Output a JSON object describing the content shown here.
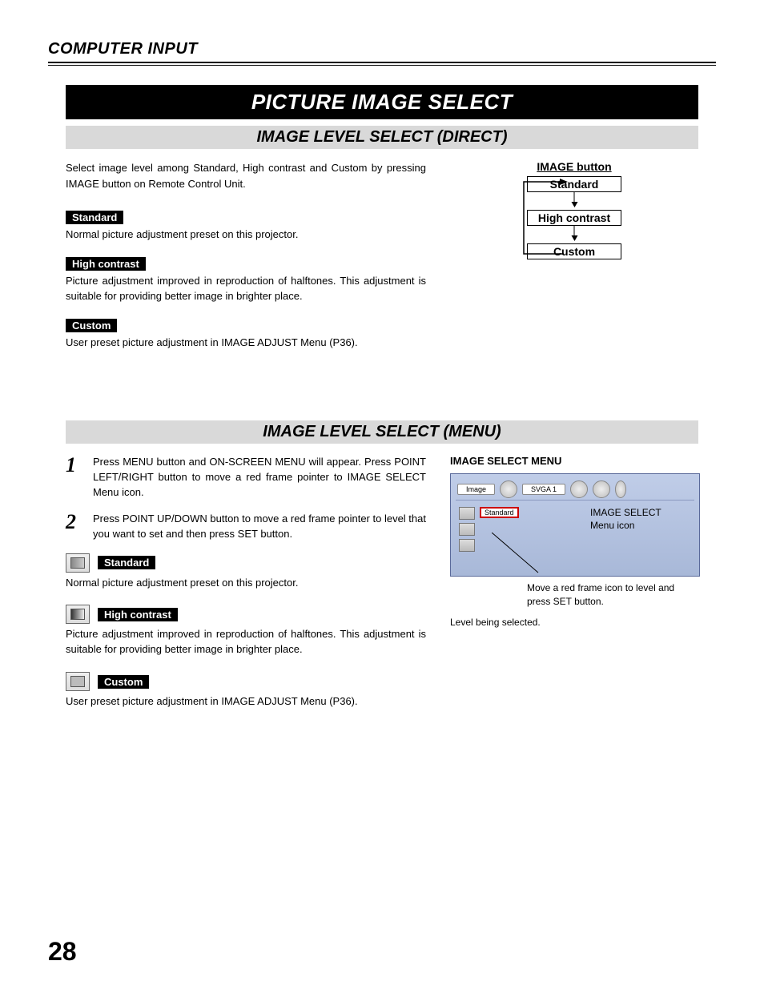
{
  "header": "COMPUTER INPUT",
  "title_bar": "PICTURE IMAGE SELECT",
  "subtitle1": "IMAGE LEVEL SELECT (DIRECT)",
  "direct": {
    "intro": "Select image level among Standard, High contrast and Custom by pressing IMAGE button on Remote Control Unit.",
    "standard_label": "Standard",
    "standard_desc": "Normal picture adjustment preset on this projector.",
    "high_label": "High contrast",
    "high_desc": "Picture adjustment improved in reproduction of halftones. This adjustment is suitable for providing better image in brighter place.",
    "custom_label": "Custom",
    "custom_desc": "User preset picture adjustment in IMAGE ADJUST Menu (P36)."
  },
  "diagram": {
    "title": "IMAGE button",
    "box1": "Standard",
    "box2": "High contrast",
    "box3": "Custom"
  },
  "subtitle2": "IMAGE LEVEL SELECT (MENU)",
  "menu": {
    "step1": "Press MENU button and ON-SCREEN MENU will appear.  Press POINT LEFT/RIGHT button to move a red frame pointer to IMAGE SELECT Menu icon.",
    "step2": "Press POINT UP/DOWN button to move a red frame pointer to level that you want to set and then press SET button.",
    "standard_label": "Standard",
    "standard_desc": "Normal picture adjustment preset on this projector.",
    "high_label": "High contrast",
    "high_desc": "Picture adjustment improved in reproduction of halftones. This adjustment is suitable for providing better image in brighter place.",
    "custom_label": "Custom",
    "custom_desc": "User preset picture adjustment in IMAGE ADJUST Menu (P36)."
  },
  "screenshot": {
    "heading": "IMAGE SELECT MENU",
    "tab1": "Image",
    "tab2": "SVGA 1",
    "red_box": "Standard",
    "annot1": "IMAGE SELECT Menu icon",
    "callout1": "Move a red frame icon to level and press SET button.",
    "callout2": "Level being selected."
  },
  "page_number": "28"
}
